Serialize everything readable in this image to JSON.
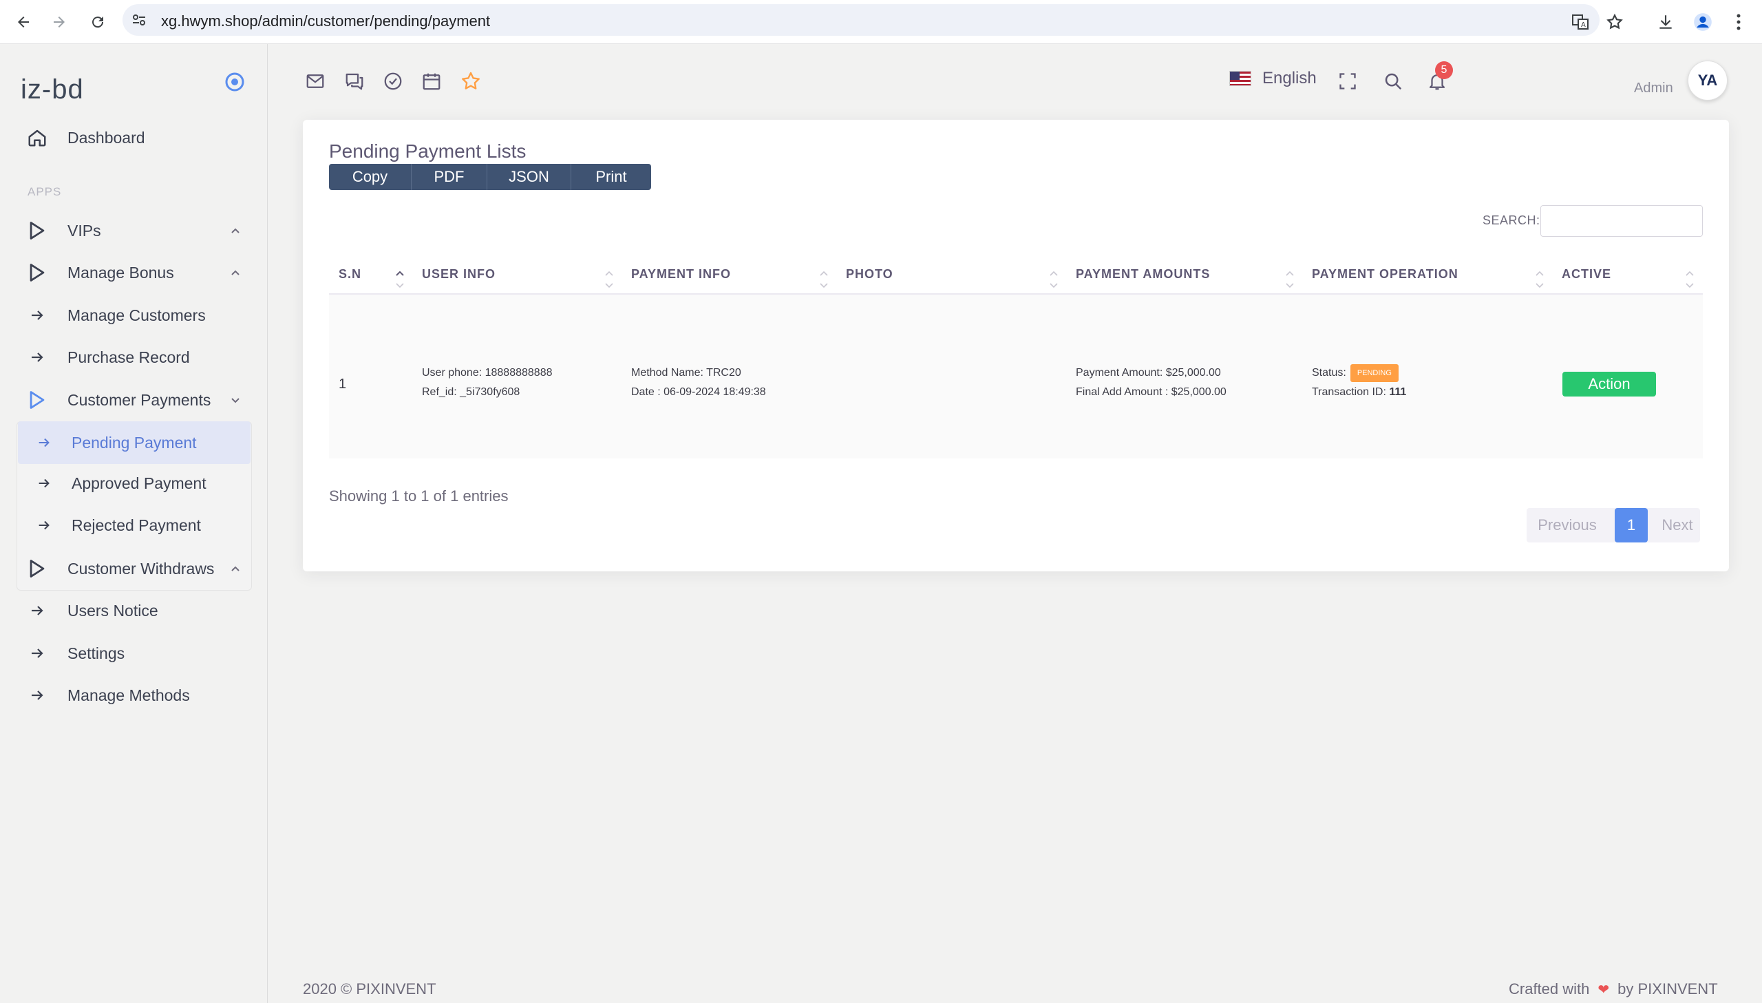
{
  "browser": {
    "url": "xg.hwym.shop/admin/customer/pending/payment"
  },
  "sidebar": {
    "brand": "iz-bd",
    "section_label": "APPS",
    "dashboard": "Dashboard",
    "items": [
      {
        "label": "VIPs"
      },
      {
        "label": "Manage Bonus"
      },
      {
        "label": "Manage Customers"
      },
      {
        "label": "Purchase Record"
      },
      {
        "label": "Customer Payments"
      },
      {
        "label": "Pending Payment"
      },
      {
        "label": "Approved Payment"
      },
      {
        "label": "Rejected Payment"
      },
      {
        "label": "Customer Withdraws"
      },
      {
        "label": "Users Notice"
      },
      {
        "label": "Settings"
      },
      {
        "label": "Manage Methods"
      }
    ]
  },
  "navbar": {
    "language": "English",
    "notification_count": "5",
    "user_role": "Admin",
    "avatar_text": "YA"
  },
  "card": {
    "title": "Pending Payment Lists",
    "buttons": [
      "Copy",
      "PDF",
      "JSON",
      "Print"
    ],
    "search_label": "SEARCH:",
    "columns": [
      "S.N",
      "USER INFO",
      "PAYMENT INFO",
      "PHOTO",
      "PAYMENT AMOUNTS",
      "PAYMENT OPERATION",
      "ACTIVE"
    ],
    "rows": [
      {
        "sn": "1",
        "user_phone": "User phone: 18888888888",
        "ref_id": "Ref_id: _5i730fy608",
        "method": "Method Name: TRC20",
        "date": "Date : 06-09-2024 18:49:38",
        "payment_amount": "Payment Amount: $25,000.00",
        "final_amount": "Final Add Amount : $25,000.00",
        "status_label": "Status:",
        "status": "PENDING",
        "transaction_label": "Transaction ID:",
        "transaction_id": "111",
        "action": "Action"
      }
    ],
    "entries_text": "Showing 1 to 1 of 1 entries",
    "pagination": {
      "previous": "Previous",
      "current": "1",
      "next": "Next"
    }
  },
  "footer": {
    "left": "2020 © PIXINVENT",
    "right_prefix": "Crafted with",
    "right_suffix": "by PIXINVENT"
  },
  "colors": {
    "accent": "#5a8dee",
    "action_green": "#28c76f",
    "pending_orange": "#ff9f43",
    "badge_red": "#ea5455",
    "button_dark": "#3f5372"
  }
}
